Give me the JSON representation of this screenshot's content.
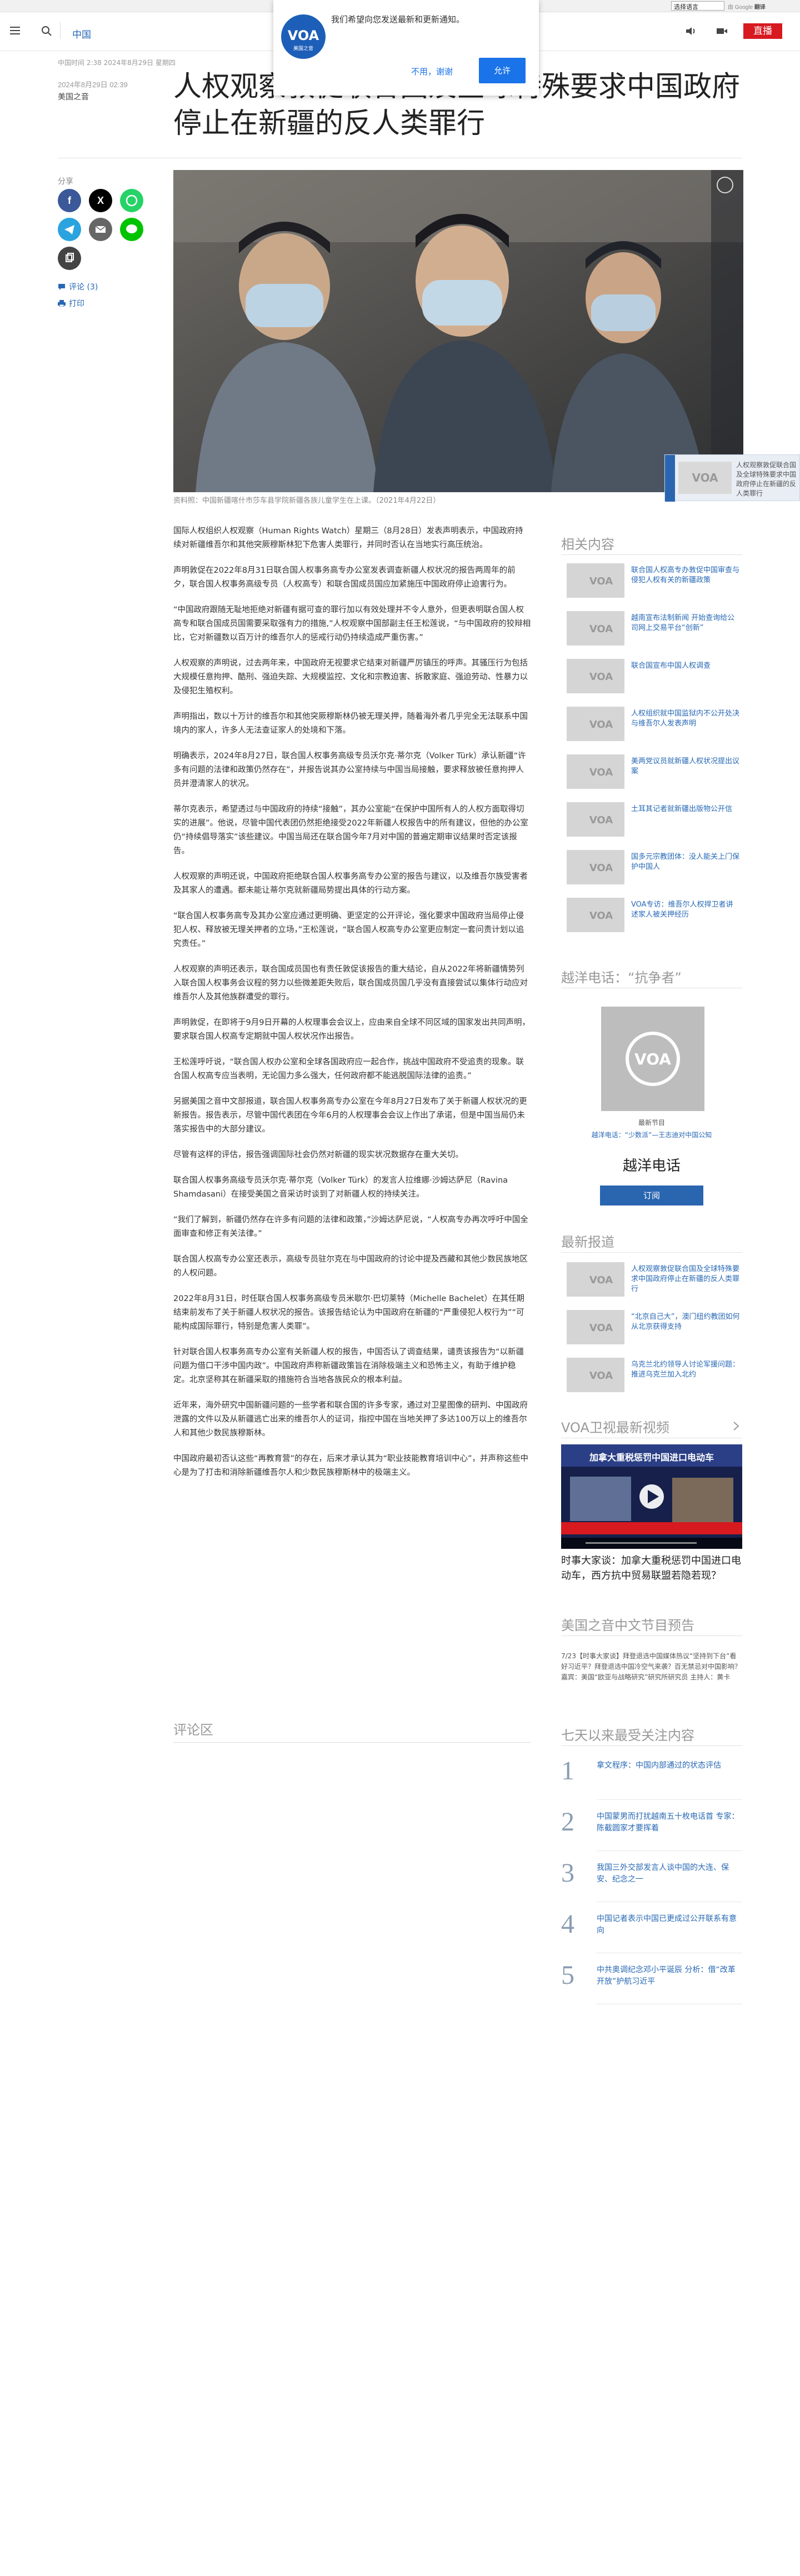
{
  "translate": {
    "selected": "选择语言",
    "credit_prefix": "由 Google",
    "credit_brand": "翻译"
  },
  "header": {
    "lang": "中国",
    "live_label": "直播"
  },
  "push_prompt": {
    "message": "我们希望向您发送最新和更新通知。",
    "deny_label": "不用，谢谢",
    "allow_label": "允许",
    "logo_text": "VOA",
    "logo_sub": "美国之音"
  },
  "article": {
    "meta_time": "中国时间 2:38 2024年8月29日 星期四",
    "date": "2024年8月29日 02:39",
    "category": "美国之音",
    "title": "人权观察敦促联合国及全球特殊要求中国政府停止在新疆的反人类罪行",
    "caption": "资料照：中国新疆喀什市莎车县学院新疆各族儿童学生在上课。（2021年4月22日）",
    "paragraphs": [
      "国际人权组织人权观察（Human Rights Watch）星期三（8月28日）发表声明表示，中国政府持续对新疆维吾尔和其他突厥穆斯林犯下危害人类罪行，并同时否认在当地实行高压统治。",
      "声明敦促在2022年8月31日联合国人权事务高专办公室发表调查新疆人权状况的报告两周年的前夕，联合国人权事务高级专员（人权高专）和联合国成员国应加紧施压中国政府停止迫害行为。",
      "“中国政府跟随无耻地拒绝对新疆有据可查的罪行加以有效处理并不令人意外，但更表明联合国人权高专和联合国成员国需要采取强有力的措施,”人权观察中国部副主任王松莲说，“与中国政府的狡辩相比，它对新疆数以百万计的维吾尔人的惩戒行动仍持续造成严重伤害。”",
      "人权观察的声明说，过去两年来，中国政府无视要求它结束对新疆严厉镇压的呼声。其骚压行为包括大规模任意拘押、酷刑、强迫失踪、大规模监控、文化和宗教迫害、拆散家庭、强迫劳动、性暴力以及侵犯生殖权利。",
      "声明指出，数以十万计的维吾尔和其他突厥穆斯林仍被无理关押，随着海外者几乎完全无法联系中国境内的家人，许多人无法查证家人的处境和下落。",
      "明确表示，2024年8月27日，联合国人权事务高级专员沃尔克·蒂尔克（Volker Türk）承认新疆“许多有问题的法律和政策仍然存在”，并报告说其办公室持续与中国当局接触，要求释放被任意拘押人员并澄清家人的状况。",
      "蒂尔克表示，希望透过与中国政府的持续“接触”，其办公室能“在保护中国所有人的人权方面取得切实的进展”。他说，尽管中国代表团仍然拒绝接受2022年新疆人权报告中的所有建议，但他的办公室仍“持续倡导落实”该些建议。中国当局还在联合国今年7月对中国的普遍定期审议结果时否定该报告。",
      "人权观察的声明还说，中国政府拒绝联合国人权事务高专办公室的报告与建议，以及维吾尔族受害者及其家人的遭遇。都未能让蒂尔克就新疆局势提出具体的行动方案。",
      "“联合国人权事务高专及其办公室应通过更明确、更坚定的公开评论，强化要求中国政府当局停止侵犯人权、释放被无理关押者的立场，”王松莲说，“联合国人权高专办公室更应制定一套问责计划以追究责任。”",
      "人权观察的声明还表示，联合国成员国也有责任敦促该报告的重大结论，自从2022年将新疆情势列入联合国人权事务会议程的努力以些微差距失败后，联合国成员国几乎没有直接尝试以集体行动应对维吾尔人及其他族群遭受的罪行。",
      "声明敦促，在即将于9月9日开幕的人权理事会会议上，应由来自全球不同区域的国家发出共同声明，要求联合国人权高专定期就中国人权状况作出报告。",
      "王松莲呼吁说，“联合国人权办公室和全球各国政府应一起合作，挑战中国政府不受追责的现象。联合国人权高专应当表明，无论国力多么强大，任何政府都不能逃脱国际法律的追责。”",
      "另据美国之音中文部报道，联合国人权事务高专办公室在今年8月27日发布了关于新疆人权状况的更新报告。报告表示，尽管中国代表团在今年6月的人权理事会会议上作出了承诺，但是中国当局仍未落实报告中的大部分建议。",
      "尽管有这样的评估，报告强调国际社会仍然对新疆的现实状况数据存在重大关切。",
      "联合国人权事务高级专员沃尔克·蒂尔克（Volker Türk）的发言人拉维娜·沙姆达萨尼（Ravina Shamdasani）在接受美国之音采访时谈到了对新疆人权的持续关注。",
      "“我们了解到，新疆仍然存在许多有问题的法律和政策，”沙姆达萨尼说，“人权高专办再次呼吁中国全面审查和修正有关法律。”",
      "联合国人权高专办公室还表示，高级专员驻尔克在与中国政府的讨论中提及西藏和其他少数民族地区的人权问题。",
      "2022年8月31日，时任联合国人权事务高级专员米歇尔·巴切莱特（Michelle Bachelet）在其任期结束前发布了关于新疆人权状况的报告。该报告结论认为中国政府在新疆的“严重侵犯人权行为”“可能构成国际罪行，特别是危害人类罪”。",
      "针对联合国人权事务高专办公室有关新疆人权的报告，中国否认了调查结果，谴责该报告为“以新疆问题为借口干涉中国内政”。中国政府声称新疆政策旨在消除极端主义和恐怖主义，有助于维护稳定。北京坚称其在新疆采取的措施符合当地各族民众的根本利益。",
      "近年来，海外研究中国新疆问题的一些学者和联合国的许多专家，通过对卫星图像的研判、中国政府泄露的文件以及从新疆逃亡出来的维吾尔人的证词，指控中国在当地关押了多达100万以上的维吾尔人和其他少数民族穆斯林。",
      "中国政府最初否认这些“再教育营”的存在，后来才承认其为“职业技能教育培训中心”，并声称这些中心是为了打击和消除新疆维吾尔人和少数民族穆斯林中的极端主义。"
    ],
    "comments_title": "评论区"
  },
  "share": {
    "label": "分享",
    "comments_link": "评论 (3)",
    "print_link": "打印"
  },
  "sidebar": {
    "related_title": "相关内容",
    "related": [
      "联合国人权高专办敦促中国审查与侵犯人权有关的新疆政策",
      "越南宣布法制新闻 开始查询给公司网上交易平台“创新”",
      "联合国宣布中国人权调查",
      "人权组织就中国监狱内不公开处决与维吾尔人发表声明",
      "美两党议员就新疆人权状况提出议案",
      "土耳其记者就新疆出版物公开信",
      "国多元宗教团体：没人能关上门保护中国人",
      "VOA专访：维吾尔人权捍卫者讲述家人被关押经历"
    ],
    "radio_title": "越洋电话：“抗争者”",
    "radio_caption": "最新节目",
    "radio_link": "越洋电话：“少数派”—王志迪对中国公知",
    "radio_name": "越洋电话",
    "subscribe_label": "订阅",
    "latest_title": "最新报道",
    "latest": [
      "人权观察敦促联合国及全球特殊要求中国政府停止在新疆的反人类罪行",
      "“北京自己大”，澳门纽约教团如何从北京获得支持",
      "乌克兰北约领导人讨论军援问题：推进乌克兰加入北约"
    ],
    "video_title": "VOA卫视最新视频",
    "video_headline": "时事大家谈：加拿大重税惩罚中国进口电动车，西方抗中贸易联盟若隐若现？",
    "video_overlay": "加拿大重税惩罚中国进口电动车",
    "schedule_title": "美国之音中文节目预告",
    "schedule_text": "7/23【时事大家谈】拜登退选中国媒体热议“坚持到下台”看好习近平？拜登退选中国冷空气来袭？百无禁忌对中国影响？ 嘉宾：美国“欧亚与战略研究”研究所研究员 主持人：黄卡",
    "popular_title": "七天以来最受关注内容",
    "popular": [
      {
        "num": "1",
        "text": "拿文程序：中国内部通过的状态评估"
      },
      {
        "num": "2",
        "text": "中国蒙男而打扰越南五十枚电话首 专家：陈截圆家才要挥着"
      },
      {
        "num": "3",
        "text": "我国三外交部发言人谈中国的大连、保安、纪念之一"
      },
      {
        "num": "4",
        "text": "中国记者表示中国已更成过公开联系有意向"
      },
      {
        "num": "5",
        "text": "中共奥调纪念邓小平诞辰 分析：借“改革开放”护航习近平"
      }
    ]
  },
  "next_float": {
    "text": "人权观察敦促联合国及全球特殊要求中国政府停止在新疆的反人类罪行"
  },
  "colors": {
    "brand_blue": "#2768b5",
    "live_red": "#d71920",
    "facebook": "#3b5998",
    "x": "#000000",
    "whatsapp": "#25d366",
    "telegram": "#2aa3df",
    "email": "#666666",
    "line": "#00c300"
  }
}
